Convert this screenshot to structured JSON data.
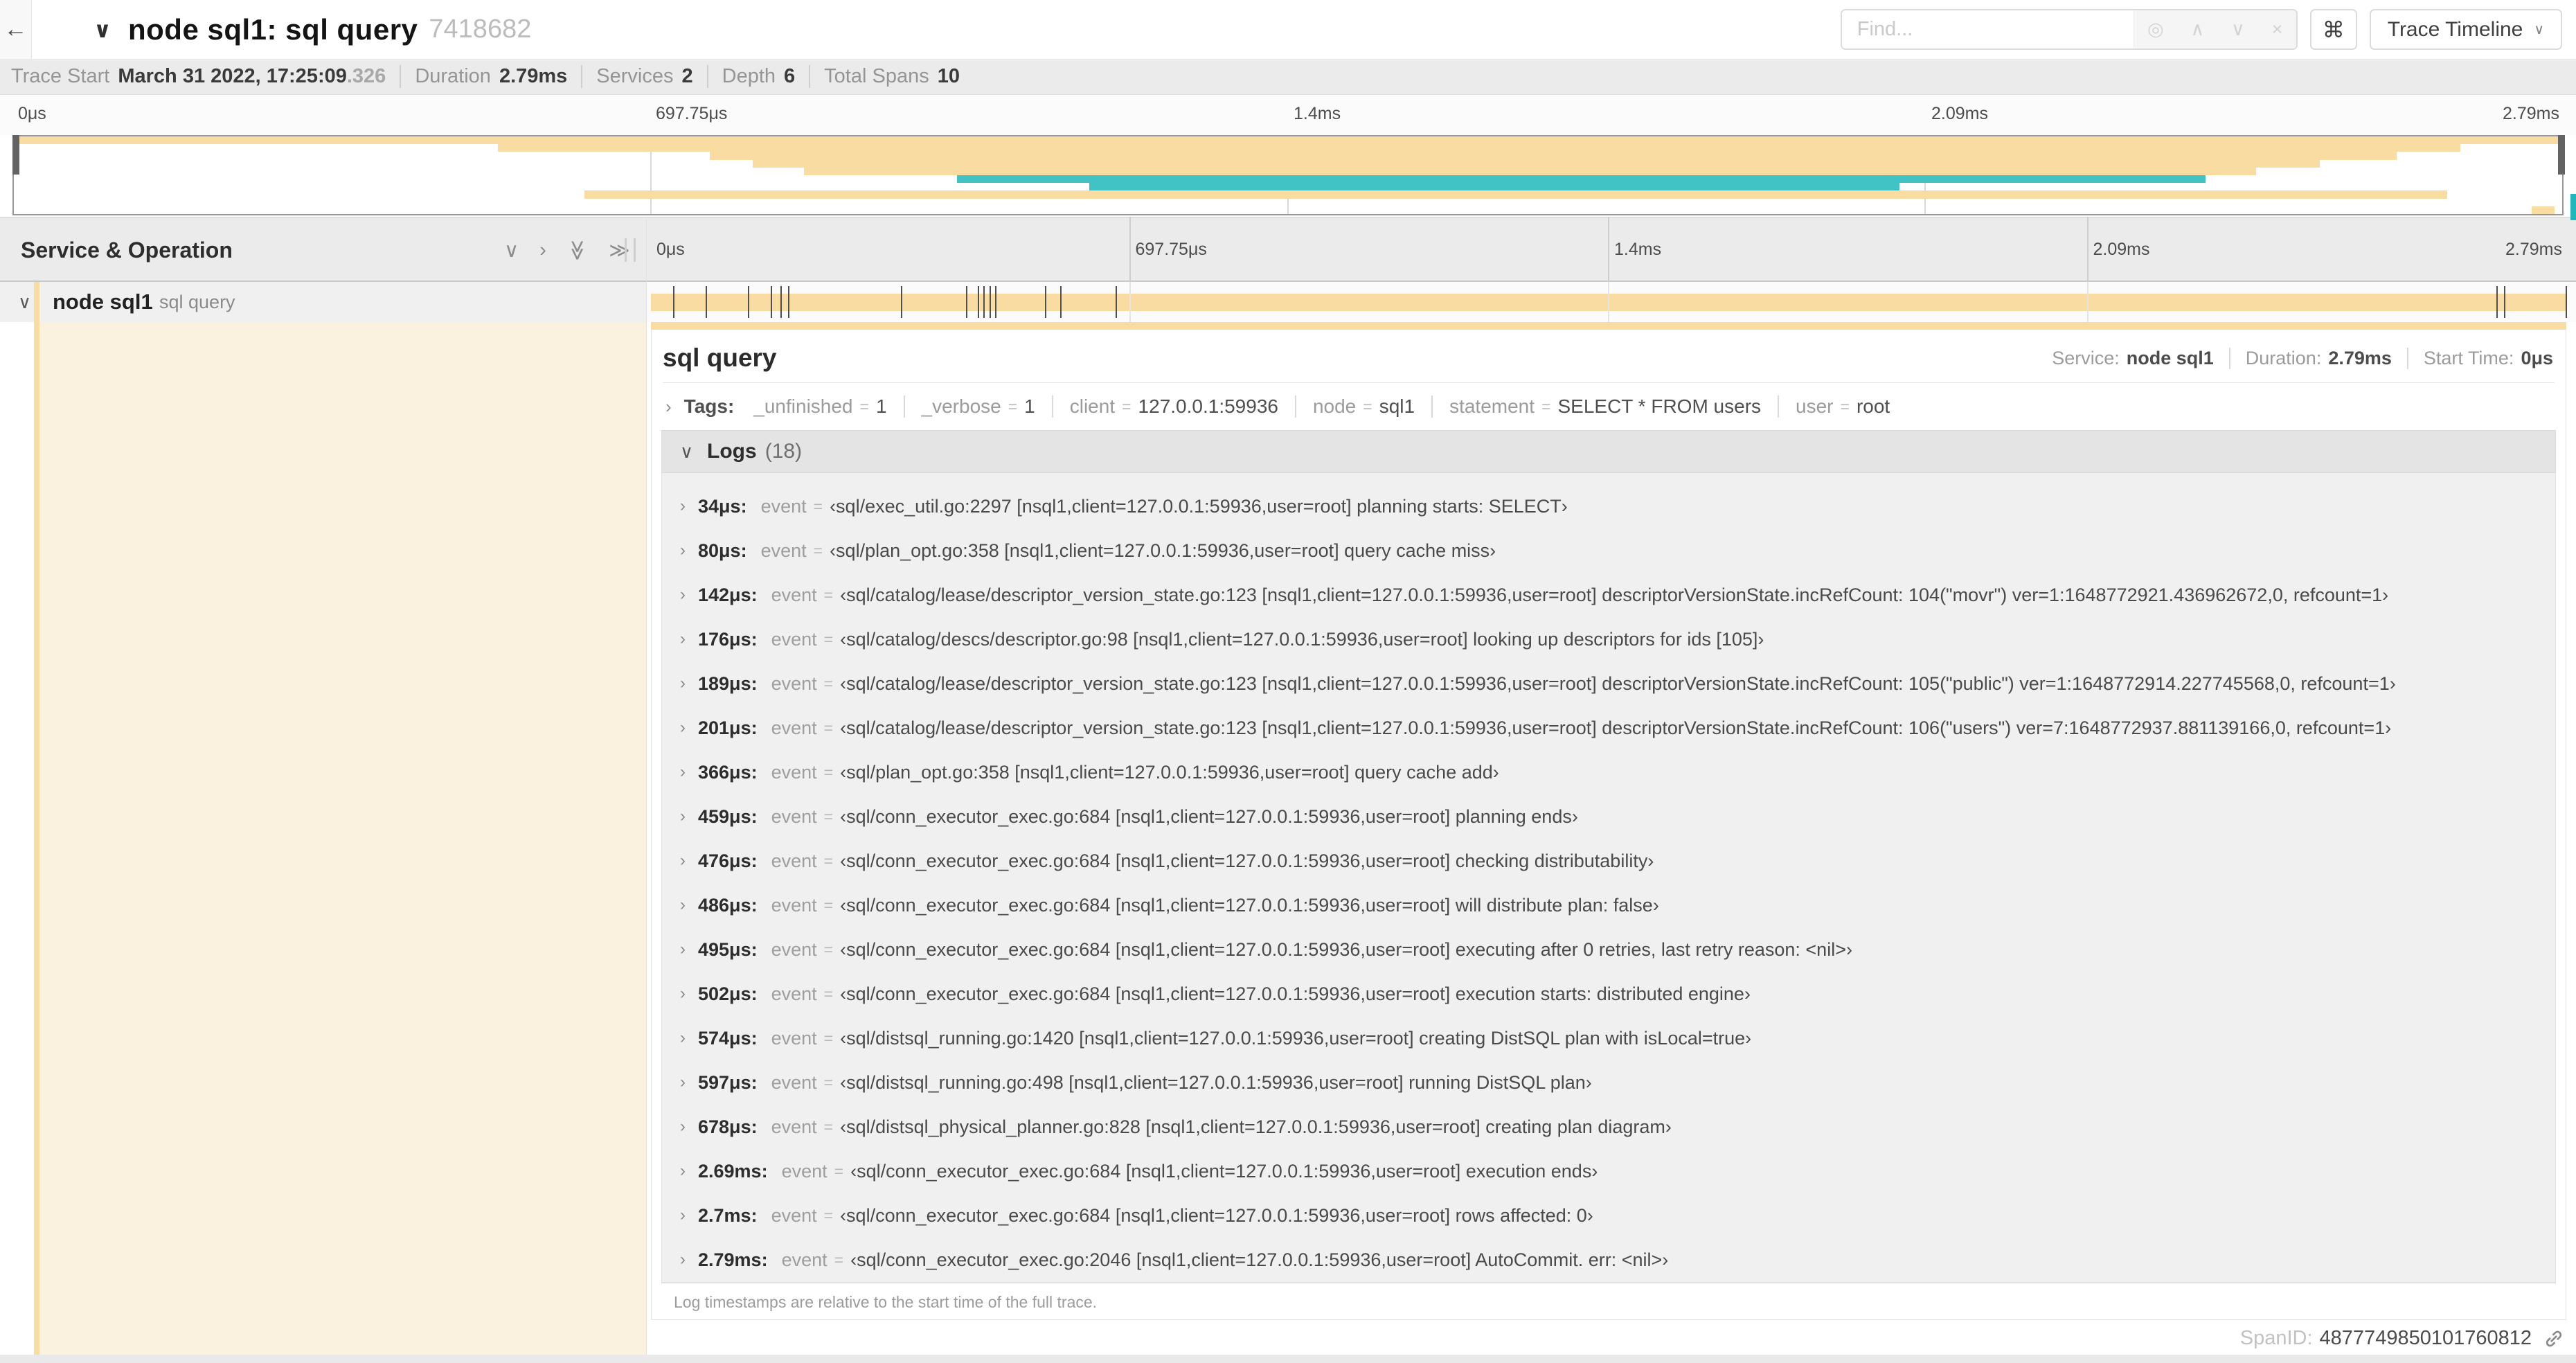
{
  "colors": {
    "tan": "#F8DCA1",
    "teal": "#41C3C5",
    "cream": "#FAF1DE",
    "tick": "#4f4f4f"
  },
  "header": {
    "back_icon": "←",
    "collapse_icon": "∨",
    "trace_name": "node sql1: sql query",
    "trace_id": "7418682",
    "find": {
      "placeholder": "Find...",
      "locate_icon": "◎",
      "prev_icon": "∧",
      "next_icon": "∨",
      "clear_icon": "×"
    },
    "shortcut_button": "⌘",
    "view_button": {
      "label": "Trace Timeline",
      "caret": "∨"
    }
  },
  "trace_info": {
    "items": [
      {
        "label": "Trace Start",
        "value": "March 31 2022, 17:25:09",
        "suffix": ".326"
      },
      {
        "label": "Duration",
        "value": "2.79ms",
        "suffix": ""
      },
      {
        "label": "Services",
        "value": "2",
        "suffix": ""
      },
      {
        "label": "Depth",
        "value": "6",
        "suffix": ""
      },
      {
        "label": "Total Spans",
        "value": "10",
        "suffix": ""
      }
    ]
  },
  "timeline": {
    "axis_labels": [
      "0μs",
      "697.75μs",
      "1.4ms",
      "2.09ms",
      "2.79ms"
    ],
    "axis_positions_pct": [
      0,
      25,
      50,
      75,
      100
    ],
    "gridline_positions_pct": [
      25,
      50,
      75
    ],
    "tick_positions_pct": [
      1.2,
      2.9,
      5.1,
      6.3,
      6.8,
      7.2,
      13.1,
      16.5,
      17.1,
      17.4,
      17.7,
      18.0,
      20.6,
      21.4,
      24.3,
      96.4,
      96.8,
      100
    ]
  },
  "minimap": {
    "spans": [
      {
        "row": 0,
        "start": 0,
        "end": 100,
        "color": "tan"
      },
      {
        "row": 1,
        "start": 19,
        "end": 96,
        "color": "tan"
      },
      {
        "row": 2,
        "start": 27.3,
        "end": 93.5,
        "color": "tan"
      },
      {
        "row": 3,
        "start": 29,
        "end": 90.5,
        "color": "tan"
      },
      {
        "row": 4,
        "start": 31,
        "end": 88,
        "color": "tan"
      },
      {
        "row": 5,
        "start": 37,
        "end": 86,
        "color": "teal"
      },
      {
        "row": 6,
        "start": 42.2,
        "end": 74,
        "color": "teal"
      },
      {
        "row": 7,
        "start": 22.4,
        "end": 95.5,
        "color": "tan"
      },
      {
        "row": 9,
        "start": 98.8,
        "end": 99.7,
        "color": "tan"
      }
    ]
  },
  "left_panel": {
    "header": "Service & Operation",
    "collapse_one_icon": "∨",
    "expand_one_icon": "›",
    "collapse_all_icon": "≫",
    "expand_all_icon": "≫",
    "row": {
      "expander": "∨",
      "service": "node sql1",
      "operation": "sql query"
    }
  },
  "detail": {
    "title": "sql query",
    "meta": [
      {
        "label": "Service:",
        "value": "node sql1"
      },
      {
        "label": "Duration:",
        "value": "2.79ms"
      },
      {
        "label": "Start Time:",
        "value": "0μs"
      }
    ],
    "tags": {
      "expander": "›",
      "label": "Tags:",
      "items": [
        {
          "key": "_unfinished",
          "value": "1"
        },
        {
          "key": "_verbose",
          "value": "1"
        },
        {
          "key": "client",
          "value": "127.0.0.1:59936"
        },
        {
          "key": "node",
          "value": "sql1"
        },
        {
          "key": "statement",
          "value": "SELECT * FROM users"
        },
        {
          "key": "user",
          "value": "root"
        }
      ]
    },
    "logs": {
      "expander": "∨",
      "label": "Logs",
      "count": "(18)",
      "row_expander": "›",
      "rows": [
        {
          "time": "34μs:",
          "field": "event",
          "value": "‹sql/exec_util.go:2297 [nsql1,client=127.0.0.1:59936,user=root] planning starts: SELECT›"
        },
        {
          "time": "80μs:",
          "field": "event",
          "value": "‹sql/plan_opt.go:358 [nsql1,client=127.0.0.1:59936,user=root] query cache miss›"
        },
        {
          "time": "142μs:",
          "field": "event",
          "value": "‹sql/catalog/lease/descriptor_version_state.go:123 [nsql1,client=127.0.0.1:59936,user=root] descriptorVersionState.incRefCount: 104(\"movr\") ver=1:1648772921.436962672,0, refcount=1›"
        },
        {
          "time": "176μs:",
          "field": "event",
          "value": "‹sql/catalog/descs/descriptor.go:98 [nsql1,client=127.0.0.1:59936,user=root] looking up descriptors for ids [105]›"
        },
        {
          "time": "189μs:",
          "field": "event",
          "value": "‹sql/catalog/lease/descriptor_version_state.go:123 [nsql1,client=127.0.0.1:59936,user=root] descriptorVersionState.incRefCount: 105(\"public\") ver=1:1648772914.227745568,0, refcount=1›"
        },
        {
          "time": "201μs:",
          "field": "event",
          "value": "‹sql/catalog/lease/descriptor_version_state.go:123 [nsql1,client=127.0.0.1:59936,user=root] descriptorVersionState.incRefCount: 106(\"users\") ver=7:1648772937.881139166,0, refcount=1›"
        },
        {
          "time": "366μs:",
          "field": "event",
          "value": "‹sql/plan_opt.go:358 [nsql1,client=127.0.0.1:59936,user=root] query cache add›"
        },
        {
          "time": "459μs:",
          "field": "event",
          "value": "‹sql/conn_executor_exec.go:684 [nsql1,client=127.0.0.1:59936,user=root] planning ends›"
        },
        {
          "time": "476μs:",
          "field": "event",
          "value": "‹sql/conn_executor_exec.go:684 [nsql1,client=127.0.0.1:59936,user=root] checking distributability›"
        },
        {
          "time": "486μs:",
          "field": "event",
          "value": "‹sql/conn_executor_exec.go:684 [nsql1,client=127.0.0.1:59936,user=root] will distribute plan: false›"
        },
        {
          "time": "495μs:",
          "field": "event",
          "value": "‹sql/conn_executor_exec.go:684 [nsql1,client=127.0.0.1:59936,user=root] executing after 0 retries, last retry reason: <nil>›"
        },
        {
          "time": "502μs:",
          "field": "event",
          "value": "‹sql/conn_executor_exec.go:684 [nsql1,client=127.0.0.1:59936,user=root] execution starts: distributed engine›"
        },
        {
          "time": "574μs:",
          "field": "event",
          "value": "‹sql/distsql_running.go:1420 [nsql1,client=127.0.0.1:59936,user=root] creating DistSQL plan with isLocal=true›"
        },
        {
          "time": "597μs:",
          "field": "event",
          "value": "‹sql/distsql_running.go:498 [nsql1,client=127.0.0.1:59936,user=root] running DistSQL plan›"
        },
        {
          "time": "678μs:",
          "field": "event",
          "value": "‹sql/distsql_physical_planner.go:828 [nsql1,client=127.0.0.1:59936,user=root] creating plan diagram›"
        },
        {
          "time": "2.69ms:",
          "field": "event",
          "value": "‹sql/conn_executor_exec.go:684 [nsql1,client=127.0.0.1:59936,user=root] execution ends›"
        },
        {
          "time": "2.7ms:",
          "field": "event",
          "value": "‹sql/conn_executor_exec.go:684 [nsql1,client=127.0.0.1:59936,user=root] rows affected: 0›"
        },
        {
          "time": "2.79ms:",
          "field": "event",
          "value": "‹sql/conn_executor_exec.go:2046 [nsql1,client=127.0.0.1:59936,user=root] AutoCommit. err: <nil>›"
        }
      ],
      "footer": "Log timestamps are relative to the start time of the full trace."
    },
    "span_id_label": "SpanID:",
    "span_id": "4877749850101760812"
  }
}
